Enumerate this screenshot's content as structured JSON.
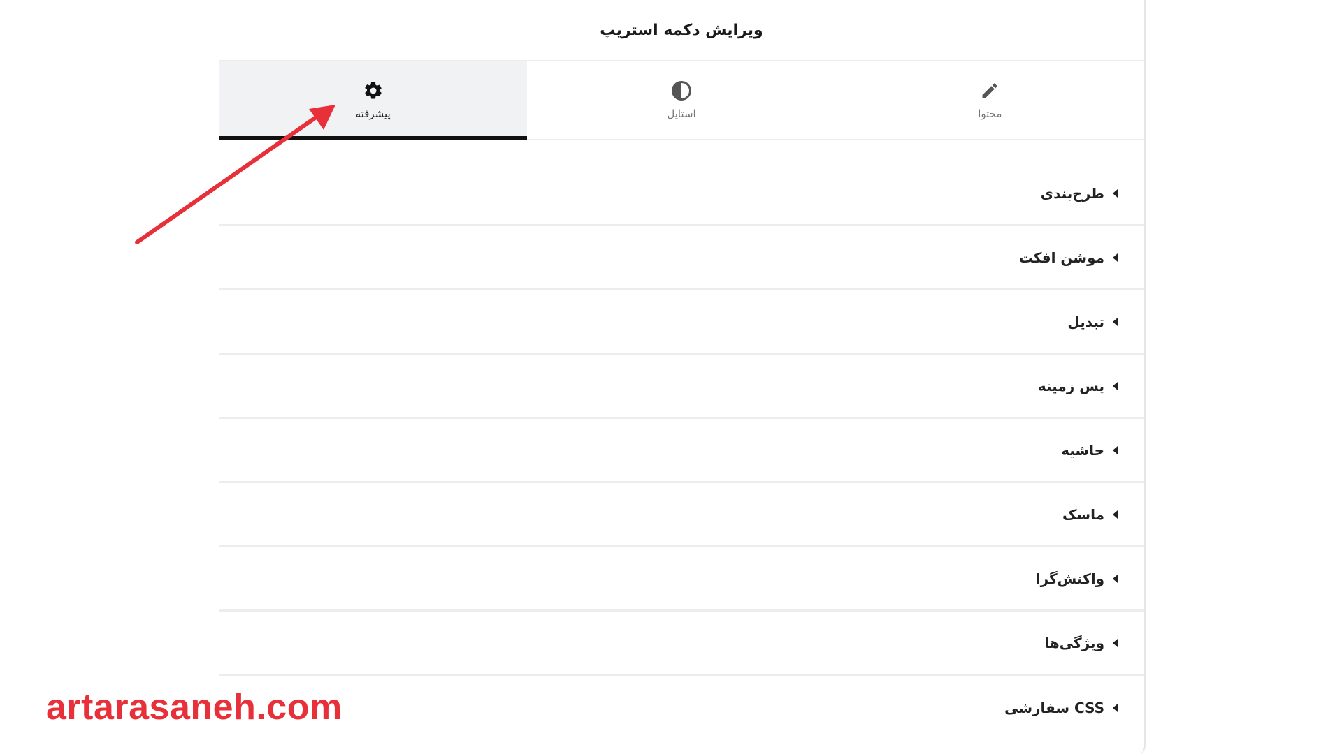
{
  "header": {
    "title": "ویرایش دکمه استریپ"
  },
  "tabs": [
    {
      "label": "محتوا",
      "icon": "pencil-icon",
      "active": false
    },
    {
      "label": "استایل",
      "icon": "contrast-icon",
      "active": false
    },
    {
      "label": "پیشرفته",
      "icon": "gear-icon",
      "active": true
    }
  ],
  "sections": [
    {
      "label": "طرح‌بندی"
    },
    {
      "label": "موشن افکت"
    },
    {
      "label": "تبدیل"
    },
    {
      "label": "پس زمینه"
    },
    {
      "label": "حاشیه"
    },
    {
      "label": "ماسک"
    },
    {
      "label": "واکنش‌گرا"
    },
    {
      "label": "ویژگی‌ها"
    },
    {
      "label": "CSS سفارشی"
    }
  ],
  "watermark": {
    "text": "artarasaneh.com"
  },
  "colors": {
    "accent_arrow": "#e8303a",
    "active_tab_bg": "#f1f2f4",
    "active_tab_underline": "#111111"
  }
}
